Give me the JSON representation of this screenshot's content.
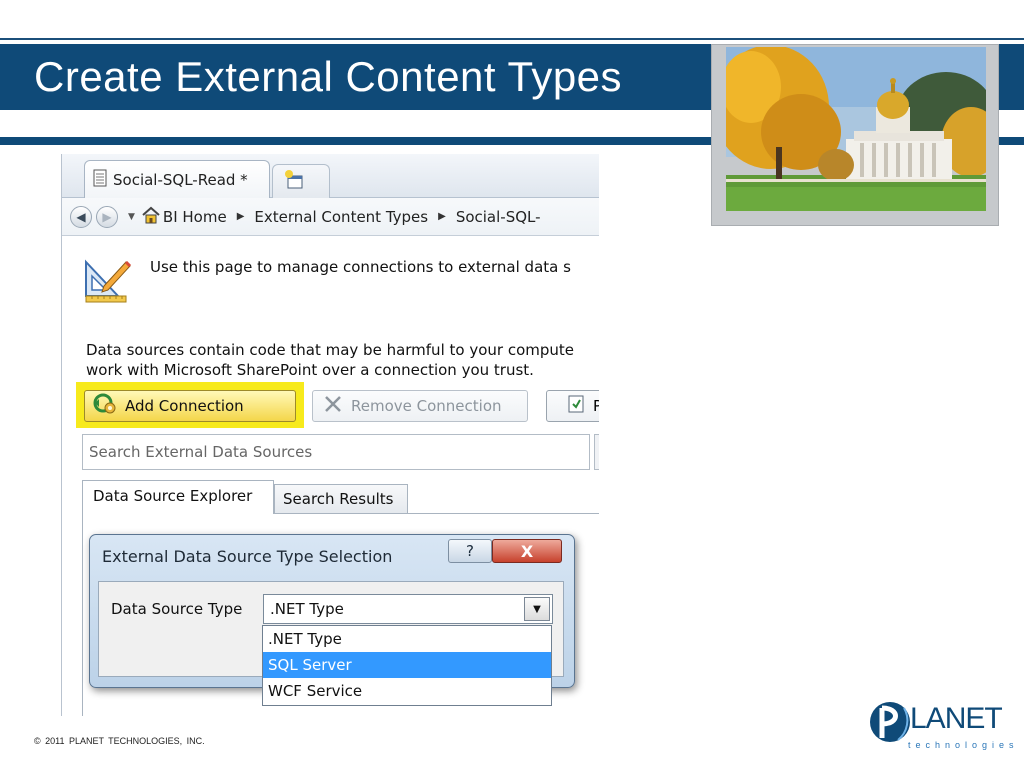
{
  "slide": {
    "title": "Create External Content Types",
    "copyright": "© 2011 PLANET TECHNOLOGIES, INC.",
    "logo": {
      "word": "LANET",
      "tagline": "technologies"
    },
    "colors": {
      "title_bar": "#0f4a78",
      "highlight": "#f7ea1c",
      "selection": "#3399ff"
    }
  },
  "app": {
    "tabs": [
      {
        "label": "Social-SQL-Read *",
        "icon": "document-icon"
      },
      {
        "label": "",
        "icon": "new-tab-icon"
      }
    ],
    "breadcrumb": {
      "home": "BI Home",
      "items": [
        "External Content Types",
        "Social-SQL-"
      ]
    },
    "intro_text": "Use this page to manage connections to external data s",
    "warning_lines": [
      "Data sources contain code that may be harmful to your compute",
      "work with Microsoft SharePoint over a connection you trust."
    ],
    "toolbar": {
      "add_connection": "Add Connection",
      "remove_connection": "Remove Connection",
      "properties_partial": "P"
    },
    "search": {
      "placeholder": "Search External Data Sources"
    },
    "explorer_tabs": [
      "Data Source Explorer",
      "Search Results"
    ]
  },
  "dialog": {
    "title": "External Data Source Type Selection",
    "help_glyph": "?",
    "close_glyph": "X",
    "field_label": "Data Source Type",
    "selected_value": ".NET Type",
    "options": [
      ".NET Type",
      "SQL Server",
      "WCF Service"
    ],
    "highlighted_index": 1
  }
}
